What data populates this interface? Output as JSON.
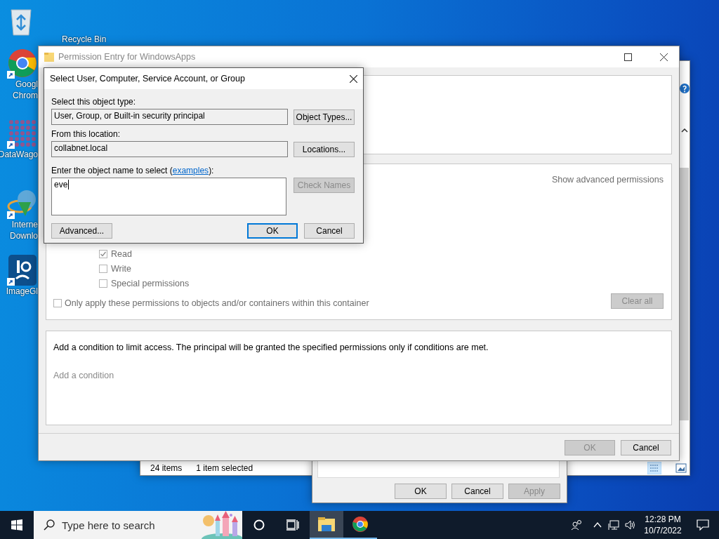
{
  "desktop_icons": [
    {
      "kind": "recycle",
      "lines": [
        "Recycle Bin"
      ]
    },
    {
      "kind": "chrome",
      "lines": [
        "Googl",
        "Chrom"
      ]
    },
    {
      "kind": "lattice",
      "lines": [
        "DataWago"
      ]
    },
    {
      "kind": "globe",
      "lines": [
        "Interne",
        "Downlo"
      ]
    },
    {
      "kind": "viewer",
      "lines": [
        "ImageGl"
      ]
    }
  ],
  "explorer": {
    "status_items": [
      "24 items",
      "1 item selected"
    ]
  },
  "properties_dialog": {
    "buttons": [
      {
        "label": "OK",
        "disabled": false
      },
      {
        "label": "Cancel",
        "disabled": false
      },
      {
        "label": "Apply",
        "disabled": true
      }
    ]
  },
  "permission_entry": {
    "title": "Permission Entry for WindowsApps",
    "show_advanced": "Show advanced permissions",
    "permissions": [
      {
        "label": "Read",
        "checked": true
      },
      {
        "label": "Write",
        "checked": false
      },
      {
        "label": "Special permissions",
        "checked": false
      }
    ],
    "only_apply": {
      "label": "Only apply these permissions to objects and/or containers within this container",
      "checked": false
    },
    "clear_all": {
      "label": "Clear all",
      "disabled": true
    },
    "condition_text": "Add a condition to limit access. The principal will be granted the specified permissions only if conditions are met.",
    "add_condition": "Add a condition",
    "buttons": [
      {
        "label": "OK",
        "disabled": true
      },
      {
        "label": "Cancel",
        "disabled": false
      }
    ]
  },
  "select_dialog": {
    "title": "Select User, Computer, Service Account, or Group",
    "object_type_label": "Select this object type:",
    "object_type": "User, Group, or Built-in security principal",
    "object_types_button": "Object Types...",
    "location_label": "From this location:",
    "location": "collabnet.local",
    "locations_button": "Locations...",
    "name_label_before": "Enter the object name to select (",
    "name_label_link": "examples",
    "name_label_after": "):",
    "name_value": "eve",
    "check_names": {
      "label": "Check Names",
      "disabled": true
    },
    "buttons": [
      {
        "label": "Advanced...",
        "disabled": false,
        "default": false
      },
      {
        "label": "OK",
        "disabled": false,
        "default": true
      },
      {
        "label": "Cancel",
        "disabled": false,
        "default": false
      }
    ]
  },
  "taskbar": {
    "search_placeholder": "Type here to search",
    "time": "12:28 PM",
    "date": "10/7/2022"
  }
}
